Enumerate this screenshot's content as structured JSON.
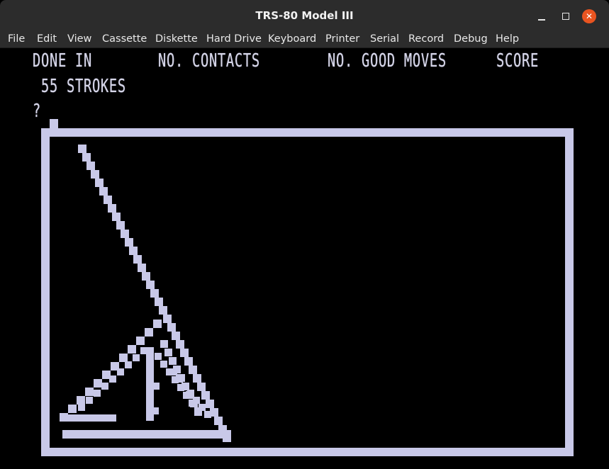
{
  "window": {
    "title": "TRS-80 Model III",
    "minimize_label": "",
    "maximize_label": "",
    "close_label": "✕"
  },
  "menu": {
    "items": [
      "File",
      "Edit",
      "View",
      "Cassette",
      "Diskette",
      "Hard Drive",
      "Keyboard",
      "Printer",
      "Serial",
      "Record",
      "Debug",
      "Help"
    ]
  },
  "screen": {
    "headers": {
      "done_in": "DONE IN",
      "contacts": "NO. CONTACTS",
      "good_moves": "NO. GOOD MOVES",
      "score": "SCORE"
    },
    "strokes": "55 STROKES",
    "prompt": "?",
    "pixel_color": "#c8c8e8",
    "background_color": "#000000"
  }
}
